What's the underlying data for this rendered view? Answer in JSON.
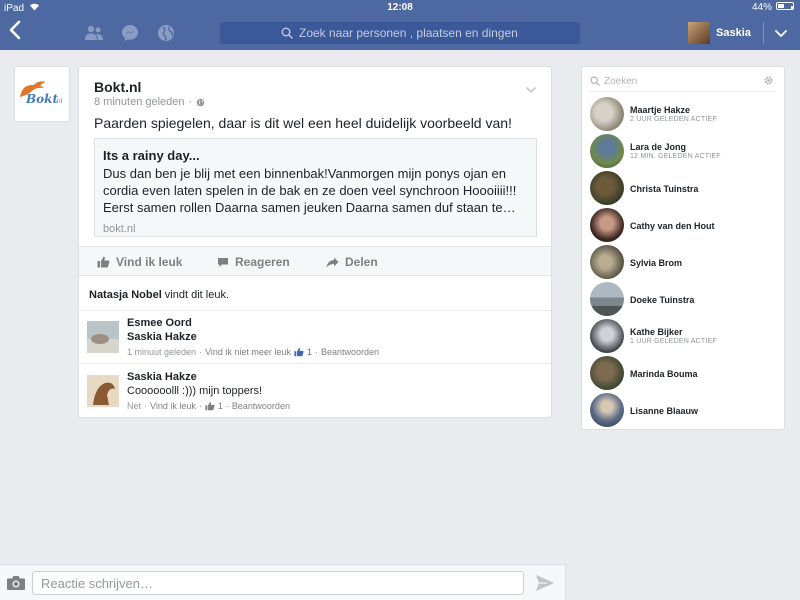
{
  "status_bar": {
    "device": "iPad",
    "time": "12:08",
    "battery": "44%"
  },
  "nav": {
    "search_placeholder": "Zoek naar personen , plaatsen en dingen",
    "profile_name": "Saskia"
  },
  "post": {
    "author": "Bokt.nl",
    "time": "8 minuten geleden",
    "text": "Paarden spiegelen, daar is dit wel een heel duidelijk voorbeeld van!",
    "link": {
      "title": "Its a rainy day...",
      "description": "Dus dan ben je blij met een binnenbak!Vanmorgen mijn ponys ojan en cordia even laten spelen in de bak en ze doen veel synchroon Hoooiiii!!! Eerst samen rollen Daarna samen jeuken Daarna samen duf staan te…",
      "domain": "bokt.nl"
    },
    "actions": {
      "like": "Vind ik leuk",
      "comment": "Reageren",
      "share": "Delen"
    },
    "likes": {
      "name": "Natasja Nobel",
      "suffix": " vindt dit leuk."
    },
    "comments": [
      {
        "author": "Esmee Oord",
        "text": "Saskia Hakze",
        "time": "1 minuut geleden",
        "like_link": "Vind ik niet meer leuk",
        "like_count": "1",
        "reply": "Beantwoorden"
      },
      {
        "author": "Saskia Hakze",
        "text": "Coooooolll :))) mijn toppers!",
        "time": "Net",
        "like_link": "Vind ik leuk",
        "like_count": "1",
        "reply": "Beantwoorden"
      }
    ]
  },
  "sidebar": {
    "search_placeholder": "Zoeken",
    "friends": [
      {
        "name": "Maartje Hakze",
        "status": "2 UUR GELEDEN ACTIEF"
      },
      {
        "name": "Lara de Jong",
        "status": "12 MIN. GELEDEN ACTIEF"
      },
      {
        "name": "Christa Tuinstra",
        "status": ""
      },
      {
        "name": "Cathy van den Hout",
        "status": ""
      },
      {
        "name": "Sylvia Brom",
        "status": ""
      },
      {
        "name": "Doeke Tuinstra",
        "status": ""
      },
      {
        "name": "Kathe Bijker",
        "status": "1 UUR GELEDEN ACTIEF"
      },
      {
        "name": "Marinda Bouma",
        "status": ""
      },
      {
        "name": "Lisanne Blaauw",
        "status": ""
      }
    ]
  },
  "composer": {
    "placeholder": "Reactie schrijven…"
  }
}
